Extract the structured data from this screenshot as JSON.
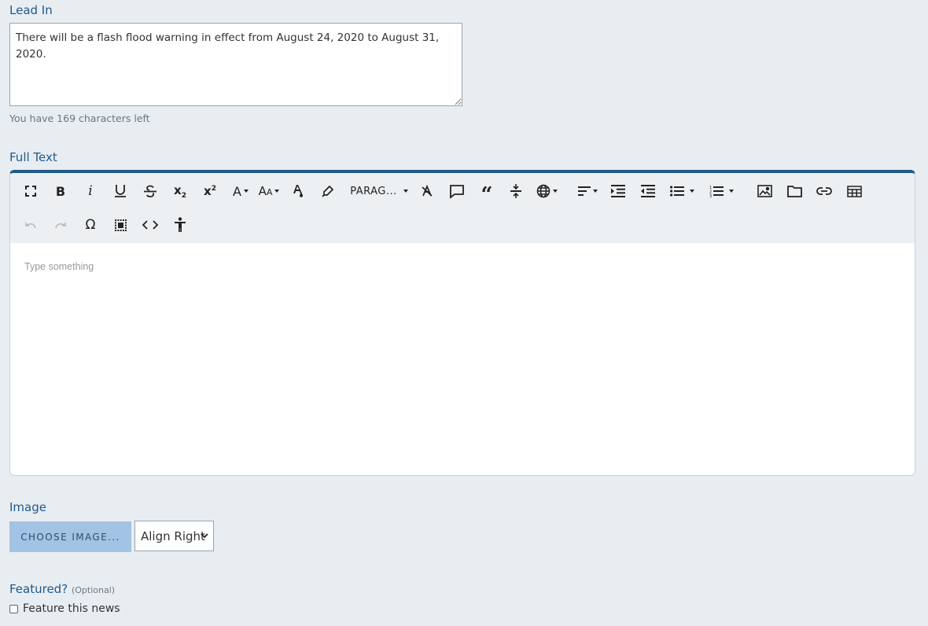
{
  "lead_in": {
    "label": "Lead In",
    "value": "There will be a flash flood warning in effect from August 24, 2020 to August 31, 2020.",
    "chars_left": "You have 169 characters left"
  },
  "full_text": {
    "label": "Full Text",
    "placeholder": "Type something",
    "paragraph_format": "PARAG...",
    "toolbar_row1": [
      "fullscreen-icon",
      "bold-icon",
      "italic-icon",
      "underline-icon",
      "strikethrough-icon",
      "subscript-icon",
      "superscript-icon",
      "font-family-icon",
      "font-size-icon",
      "text-color-icon",
      "background-color-icon",
      "paragraph-format",
      "clear-formatting-icon",
      "inline-class-icon",
      "quote-icon",
      "line-height-icon",
      "language-icon",
      "align-icon",
      "indent-icon",
      "outdent-icon",
      "unordered-list-icon",
      "ordered-list-icon",
      "insert-image-icon",
      "insert-file-icon",
      "insert-link-icon",
      "insert-table-icon"
    ],
    "toolbar_row2": [
      "undo-icon",
      "redo-icon",
      "special-characters-icon",
      "select-all-icon",
      "code-view-icon",
      "accessibility-icon"
    ]
  },
  "image": {
    "label": "Image",
    "choose_label": "CHOOSE IMAGE...",
    "align_value": "Align Right"
  },
  "featured": {
    "label": "Featured?",
    "optional": "(Optional)",
    "checkbox_label": "Feature this news",
    "checked": false
  },
  "colors": {
    "background": "#e8edf2",
    "accent": "#1f5a8a",
    "button": "#a3c3e4"
  }
}
